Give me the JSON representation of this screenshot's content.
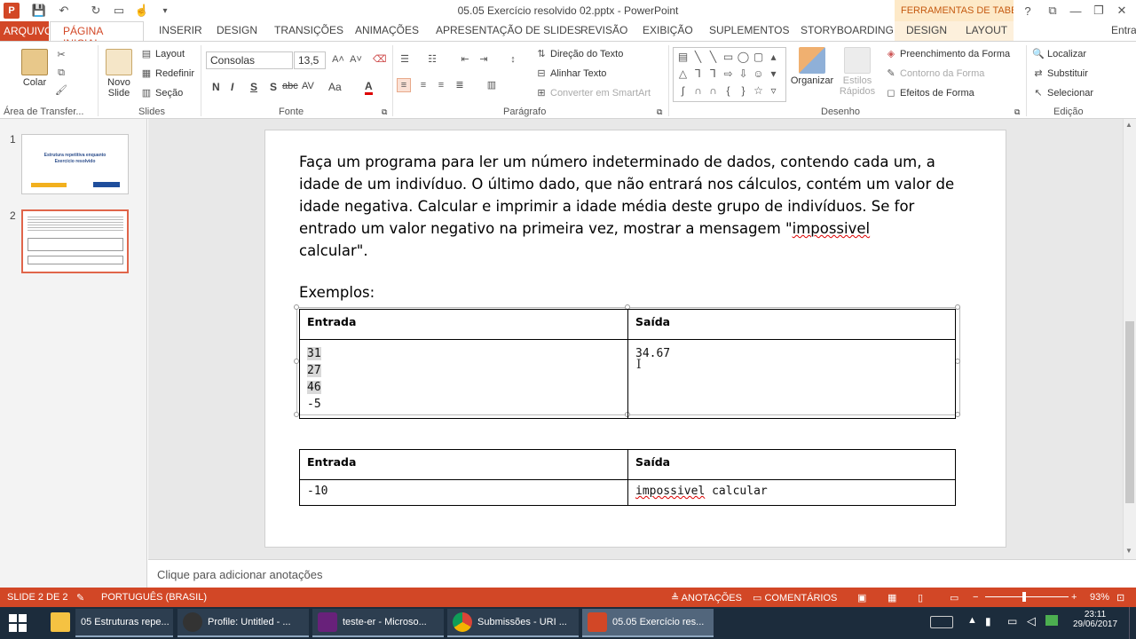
{
  "window": {
    "title": "05.05 Exercício resolvido 02.pptx - PowerPoint",
    "context_tools": "FERRAMENTAS DE TABE...",
    "help": "?",
    "controls": [
      "⧉",
      "—",
      "❐",
      "✕"
    ]
  },
  "tabs": {
    "file": "ARQUIVO",
    "home": "PÁGINA INICIAL",
    "items": [
      "INSERIR",
      "DESIGN",
      "TRANSIÇÕES",
      "ANIMAÇÕES",
      "APRESENTAÇÃO DE SLIDES",
      "REVISÃO",
      "EXIBIÇÃO",
      "SUPLEMENTOS",
      "STORYBOARDING"
    ],
    "context": [
      "DESIGN",
      "LAYOUT"
    ],
    "signin": "Entra"
  },
  "ribbon": {
    "clipboard": {
      "paste": "Colar",
      "label": "Área de Transfer..."
    },
    "slides": {
      "new_slide_1": "Novo",
      "new_slide_2": "Slide",
      "layout": "Layout",
      "reset": "Redefinir",
      "section": "Seção",
      "label": "Slides"
    },
    "font": {
      "name": "Consolas",
      "size": "13,5",
      "label": "Fonte",
      "bold": "N",
      "italic": "I",
      "underline": "S",
      "shadow": "S",
      "strike": "abc",
      "spacing": "AV",
      "case": "Aa",
      "color": "A"
    },
    "paragraph": {
      "text_direction": "Direção do Texto",
      "align_text": "Alinhar Texto",
      "smartart": "Converter em SmartArt",
      "label": "Parágrafo"
    },
    "drawing": {
      "arrange": "Organizar",
      "quick_styles_1": "Estilos",
      "quick_styles_2": "Rápidos",
      "fill": "Preenchimento da Forma",
      "outline": "Contorno da Forma",
      "effects": "Efeitos de Forma",
      "label": "Desenho"
    },
    "editing": {
      "find": "Localizar",
      "replace": "Substituir",
      "select": "Selecionar",
      "label": "Edição"
    }
  },
  "thumbnails": [
    {
      "number": "1",
      "title": "Estrutura repetitiva enquanto",
      "subtitle": "Exercício resolvido"
    },
    {
      "number": "2"
    }
  ],
  "slide": {
    "question_parts": [
      "Faça um programa para ler um número indeterminado de dados, contendo cada um, a idade de um indivíduo. O último dado, que não entrará nos cálculos, contém um valor de idade negativa. Calcular e imprimir a idade média deste grupo de indivíduos. Se for entrado um valor negativo na primeira vez, mostrar a mensagem \"",
      "impossivel",
      "\ncalcular\"."
    ],
    "examples_label": "Exemplos:",
    "table1": {
      "headers": [
        "Entrada",
        "Saída"
      ],
      "input_lines": [
        "31",
        "27",
        "46",
        "-5"
      ],
      "output": "34.67"
    },
    "table2": {
      "headers": [
        "Entrada",
        "Saída"
      ],
      "input": "-10",
      "output_word": "impossivel",
      "output_rest": " calcular"
    }
  },
  "notes": {
    "placeholder": "Clique para adicionar anotações"
  },
  "status": {
    "slide": "SLIDE 2 DE 2",
    "language": "PORTUGUÊS (BRASIL)",
    "notes": "ANOTAÇÕES",
    "comments": "COMENTÁRIOS",
    "zoom": "93%"
  },
  "taskbar": {
    "items": [
      "05 Estruturas repe...",
      "Profile: Untitled - ...",
      "teste-er - Microso...",
      "Submissões - URI ...",
      "05.05 Exercício res..."
    ],
    "time": "23:11",
    "date": "29/06/2017"
  },
  "colors": {
    "accent": "#d24726",
    "taskbar": "#1c2c3c"
  }
}
